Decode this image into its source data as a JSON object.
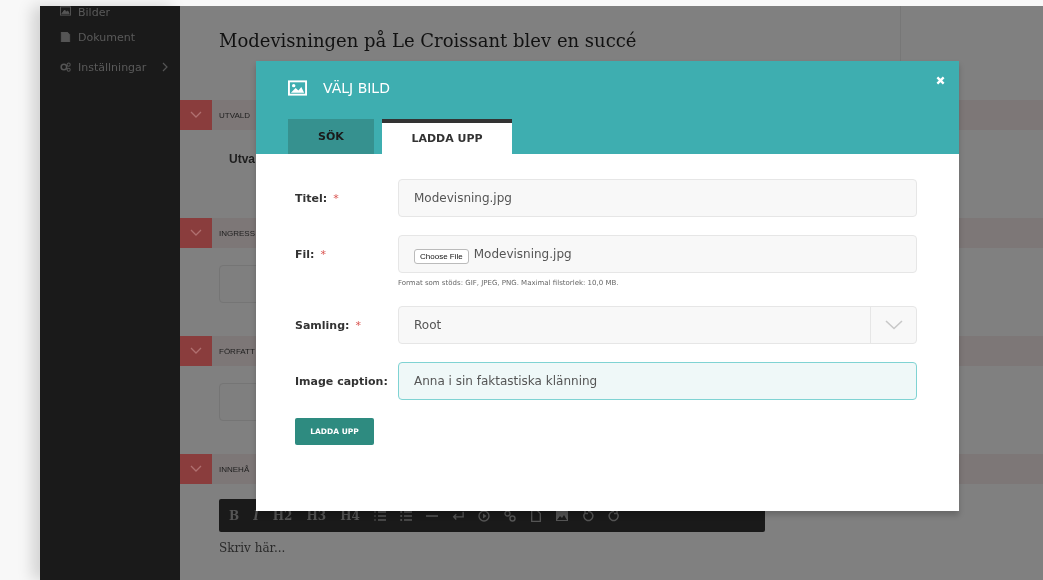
{
  "sidebar": {
    "items": [
      {
        "label": "Bilder",
        "expandable": false
      },
      {
        "label": "Dokument",
        "expandable": false
      },
      {
        "label": "Inställningar",
        "expandable": true
      }
    ]
  },
  "article": {
    "title": "Modevisningen på Le Croissant blev en succé",
    "sections": [
      {
        "label": "UTVALD",
        "kind": "text",
        "text": "Utva"
      },
      {
        "label": "INGRESS",
        "kind": "input"
      },
      {
        "label": "FÖRFATT",
        "kind": "input"
      },
      {
        "label": "INNEHÅ",
        "kind": "editor",
        "toolbar": [
          "B",
          "I",
          "H2",
          "H3",
          "H4"
        ],
        "placeholder": "Skriv här..."
      }
    ]
  },
  "modal": {
    "title": "VÄLJ BILD",
    "required_mark": "*",
    "tabs": [
      {
        "label": "SÖK",
        "selected": false
      },
      {
        "label": "LADDA UPP",
        "selected": true
      }
    ],
    "fields": [
      {
        "kind": "text",
        "label": "Titel:",
        "required": true,
        "value": "Modevisning.jpg",
        "focused": false
      },
      {
        "kind": "file",
        "label": "Fil:",
        "required": true,
        "button_label": "Choose File",
        "value": "Modevisning.jpg",
        "hint": "Format som stöds: GIF, JPEG, PNG. Maximal filstorlek: 10,0 MB.",
        "focused": false
      },
      {
        "kind": "select",
        "label": "Samling:",
        "required": true,
        "value": "Root",
        "focused": false
      },
      {
        "kind": "text",
        "label": "Image caption:",
        "required": false,
        "value": "Anna i sin faktastiska klänning",
        "focused": true
      }
    ],
    "submit": "LADDA UPP"
  }
}
